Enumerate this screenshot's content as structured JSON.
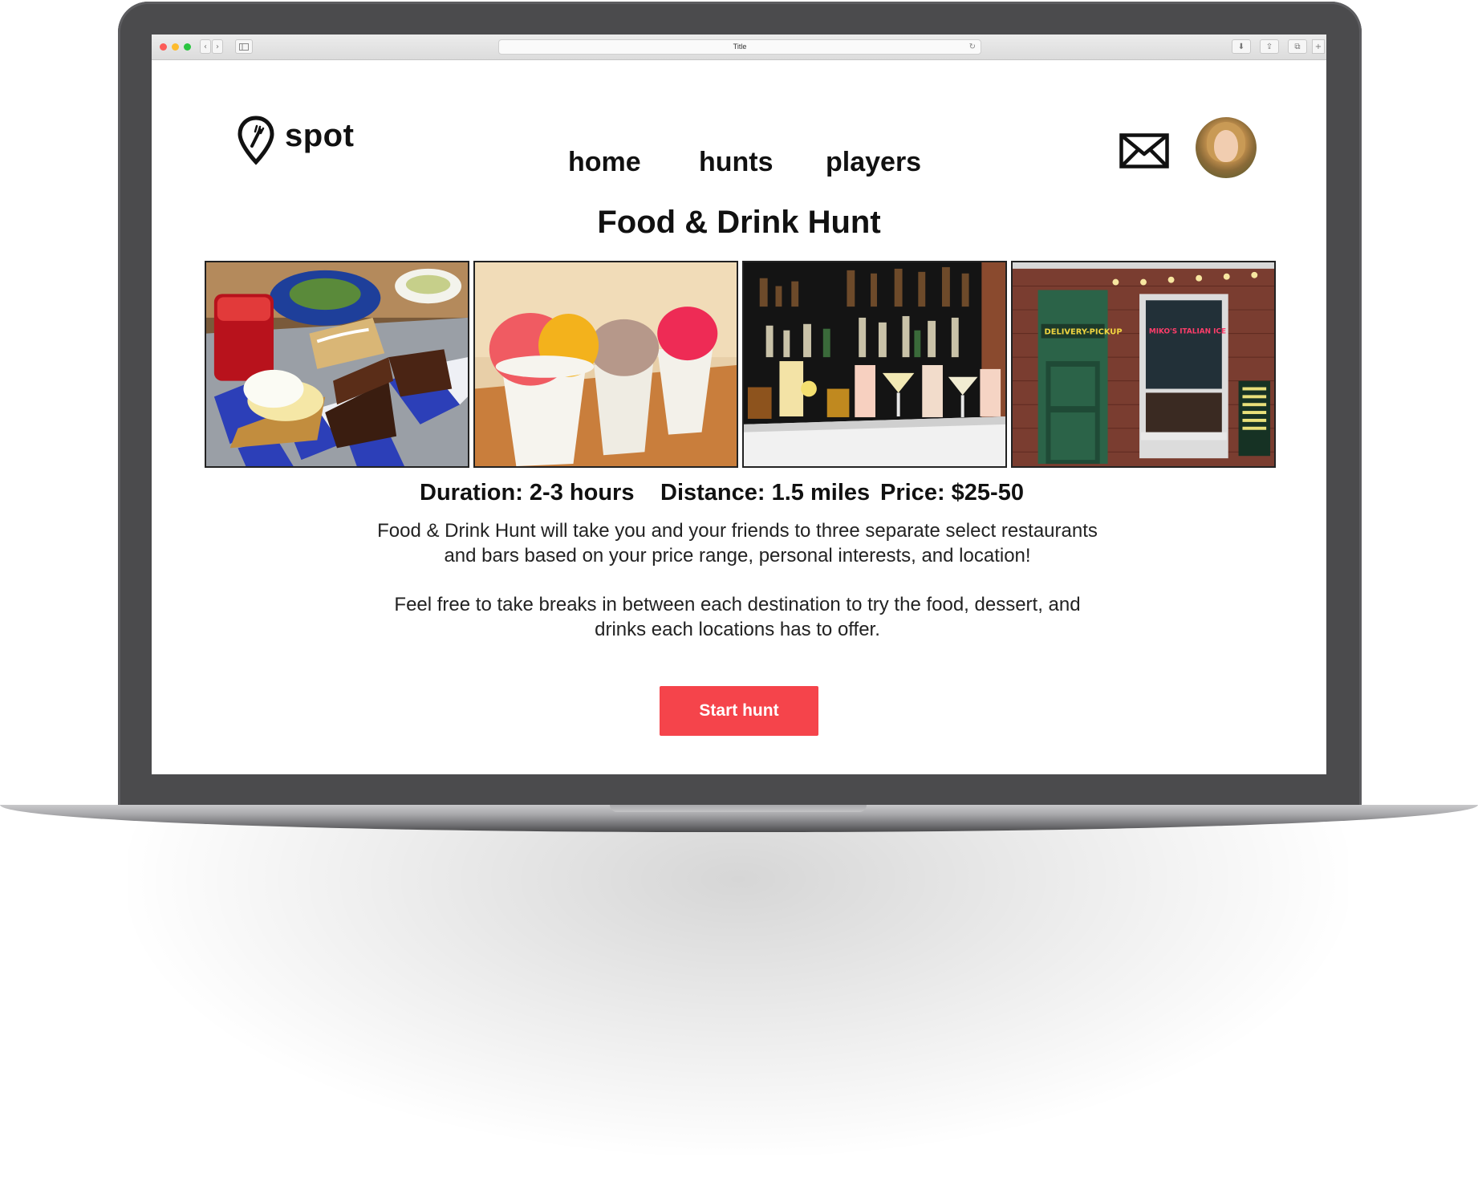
{
  "browser": {
    "tab_title": "Title",
    "back_glyph": "‹",
    "forward_glyph": "›",
    "reload_glyph": "↻",
    "download_glyph": "⬇",
    "share_glyph": "⇪",
    "tabs_glyph": "⧉",
    "newtab_glyph": "+"
  },
  "site": {
    "logo_text": "spot",
    "logo_icon": "map-pin-fork-icon"
  },
  "nav": {
    "items": [
      {
        "label": "home"
      },
      {
        "label": "hunts"
      },
      {
        "label": "players"
      }
    ]
  },
  "header_actions": {
    "mail_icon": "envelope-icon",
    "avatar_icon": "user-avatar"
  },
  "hunt": {
    "title": "Food & Drink Hunt",
    "photos": [
      {
        "name": "desserts-photo"
      },
      {
        "name": "italian-ice-photo"
      },
      {
        "name": "bar-cocktails-photo"
      },
      {
        "name": "storefront-photo"
      }
    ],
    "storefront_sign": "MIKO'S ITALIAN ICE",
    "delivery_sign": "DELIVERY-PICKUP",
    "duration": "Duration: 2-3 hours",
    "distance": "Distance: 1.5 miles",
    "price": "Price: $25-50",
    "description_1": "Food & Drink Hunt will take you and your friends to three separate select restaurants and bars based on your price range, personal interests, and location!",
    "description_2": "Feel free to take breaks in between each destination to try the food, dessert, and drinks each locations has to offer.",
    "cta_label": "Start hunt"
  },
  "colors": {
    "accent": "#f5444b",
    "text": "#111111",
    "laptop_frame": "#4b4b4d"
  }
}
